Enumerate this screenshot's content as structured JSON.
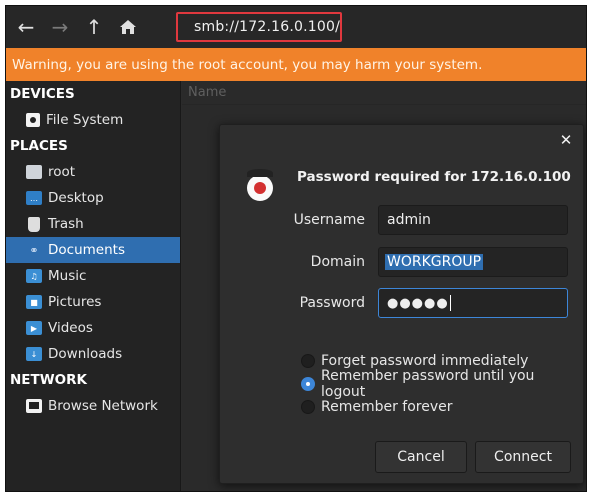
{
  "toolbar": {
    "back_icon": "arrow-left-icon",
    "forward_icon": "arrow-right-icon",
    "up_icon": "arrow-up-icon",
    "home_icon": "home-icon",
    "location": "smb://172.16.0.100/"
  },
  "warning": "Warning, you are using the root account, you may harm your system.",
  "sidebar": {
    "devices_heading": "DEVICES",
    "devices": [
      {
        "label": "File System",
        "icon": "drive-icon"
      }
    ],
    "places_heading": "PLACES",
    "places": [
      {
        "label": "root",
        "icon": "home-folder-icon"
      },
      {
        "label": "Desktop",
        "icon": "desktop-folder-icon"
      },
      {
        "label": "Trash",
        "icon": "trash-icon"
      },
      {
        "label": "Documents",
        "icon": "documents-folder-icon",
        "selected": true
      },
      {
        "label": "Music",
        "icon": "music-folder-icon"
      },
      {
        "label": "Pictures",
        "icon": "pictures-folder-icon"
      },
      {
        "label": "Videos",
        "icon": "videos-folder-icon"
      },
      {
        "label": "Downloads",
        "icon": "downloads-folder-icon"
      }
    ],
    "network_heading": "NETWORK",
    "network": [
      {
        "label": "Browse Network",
        "icon": "network-icon"
      }
    ]
  },
  "content": {
    "column_name": "Name"
  },
  "dialog": {
    "title": "Password required for 172.16.0.100",
    "close_icon": "close-icon",
    "username_label": "Username",
    "username_value": "admin",
    "domain_label": "Domain",
    "domain_value": "WORKGROUP",
    "password_label": "Password",
    "password_value": "●●●●●",
    "options": [
      {
        "label": "Forget password immediately",
        "checked": false
      },
      {
        "label": "Remember password until you logout",
        "checked": true
      },
      {
        "label": "Remember forever",
        "checked": false
      }
    ],
    "cancel_label": "Cancel",
    "connect_label": "Connect"
  },
  "colors": {
    "warning": "#f0822a",
    "selection": "#2f6eb0",
    "highlight_border": "#e0383e"
  }
}
